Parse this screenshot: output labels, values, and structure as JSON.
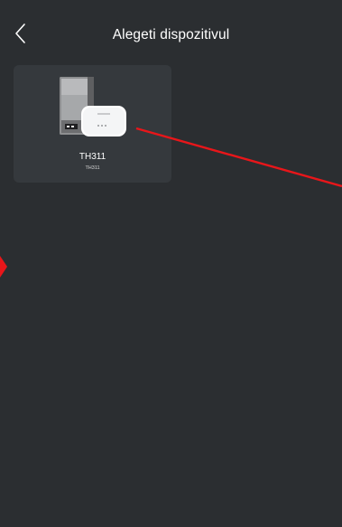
{
  "header": {
    "title": "Alegeti dispozitivul",
    "back_icon": "chevron-left-icon"
  },
  "devices": [
    {
      "name": "TH311",
      "model": "TH311",
      "image_icon": "boiler-and-hub-device-icon"
    }
  ],
  "colors": {
    "background": "#2b2e31",
    "card": "#35393d",
    "text": "#ffffff",
    "annotation": "#e8161a"
  }
}
